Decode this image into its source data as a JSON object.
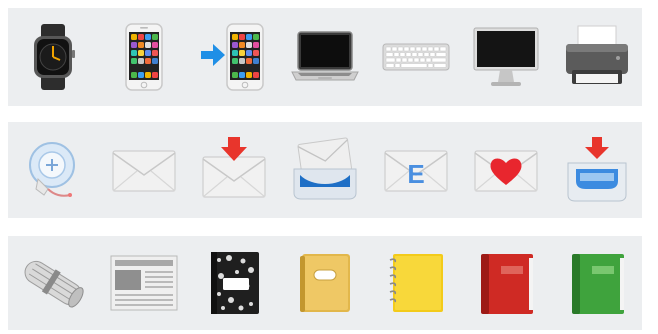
{
  "rows": [
    {
      "items": [
        {
          "icon": "watch-icon"
        },
        {
          "icon": "mobile-phone-icon"
        },
        {
          "icon": "mobile-phone-with-arrow-icon"
        },
        {
          "icon": "laptop-icon"
        },
        {
          "icon": "keyboard-icon"
        },
        {
          "icon": "desktop-computer-icon"
        },
        {
          "icon": "printer-icon"
        }
      ]
    },
    {
      "items": [
        {
          "icon": "email-symbol-icon"
        },
        {
          "icon": "envelope-icon"
        },
        {
          "icon": "envelope-with-arrow-icon"
        },
        {
          "icon": "incoming-envelope-tray-icon"
        },
        {
          "icon": "e-mail-icon",
          "label": "E"
        },
        {
          "icon": "love-letter-icon"
        },
        {
          "icon": "inbox-tray-icon"
        }
      ]
    },
    {
      "items": [
        {
          "icon": "rolled-up-newspaper-icon"
        },
        {
          "icon": "newspaper-icon"
        },
        {
          "icon": "composition-notebook-icon"
        },
        {
          "icon": "ledger-icon"
        },
        {
          "icon": "notebook-icon"
        },
        {
          "icon": "red-book-icon"
        },
        {
          "icon": "green-book-icon"
        }
      ]
    }
  ],
  "colors": {
    "strip_background": "#eceef0",
    "arrow_blue": "#1f8fe6",
    "arrow_red": "#e8352c",
    "heart_red": "#e8262e",
    "letter_blue": "#4a8fe0",
    "ledger_yellow": "#e2b74b",
    "notebook_yellow": "#f3cb1a",
    "book_red": "#cf2a24",
    "book_green": "#3fa33d"
  }
}
